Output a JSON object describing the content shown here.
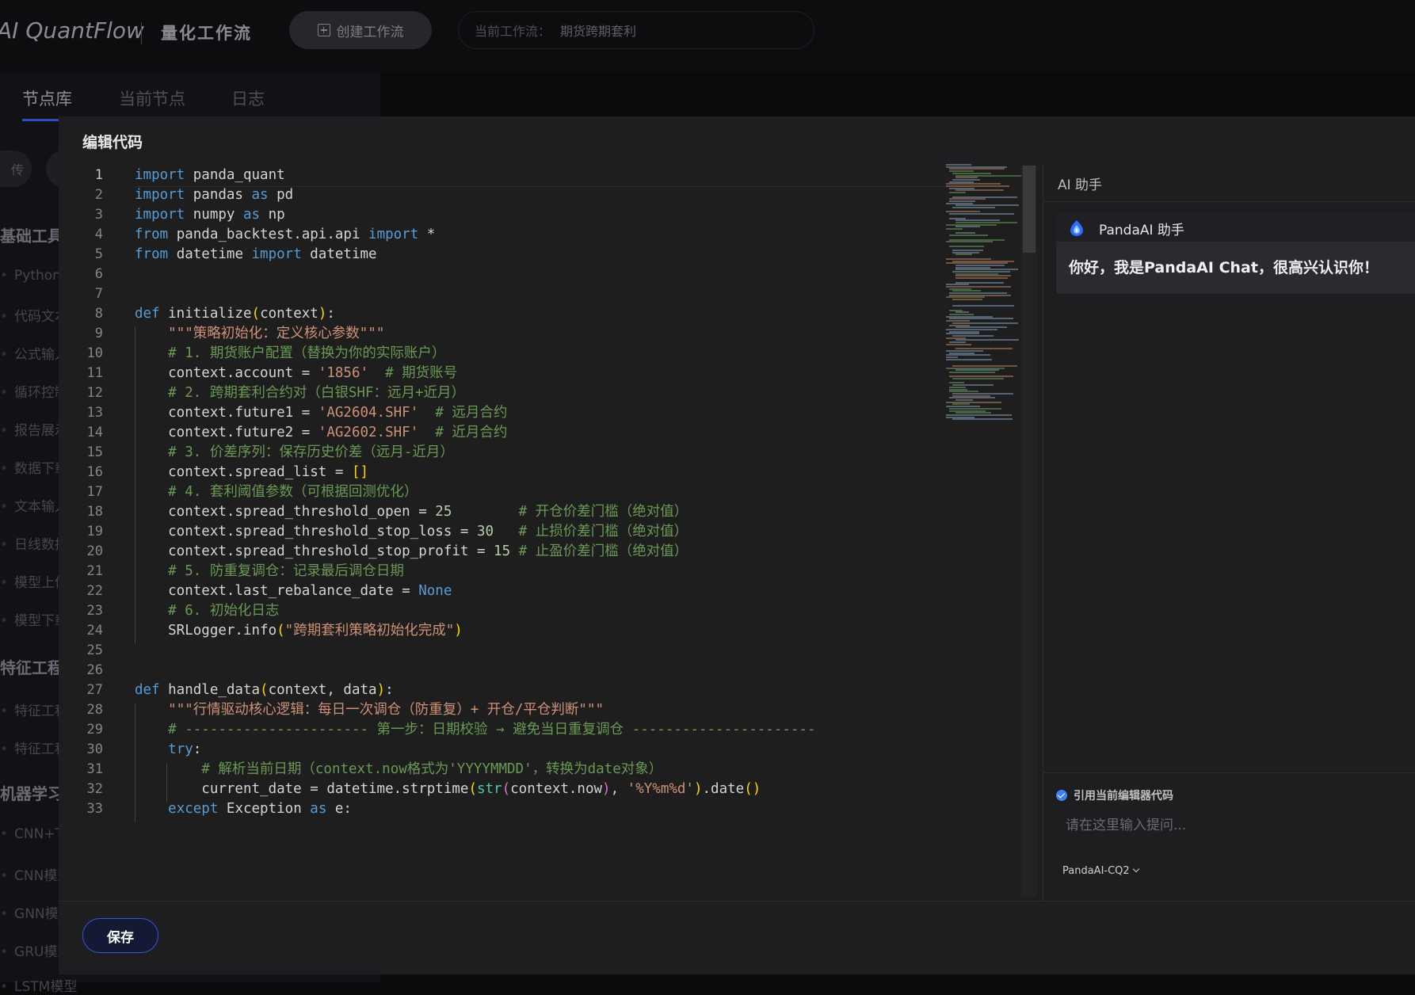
{
  "header": {
    "brand": "AI QuantFlow",
    "subbrand": "量化工作流",
    "create_button": "创建工作流",
    "current_workflow_label": "当前工作流：",
    "current_workflow_value": "期货跨期套利"
  },
  "left_tabs": [
    {
      "label": "节点库",
      "active": true
    },
    {
      "label": "当前节点",
      "active": false
    },
    {
      "label": "日志",
      "active": false
    }
  ],
  "left_panel": {
    "upload_label": "传",
    "categories": [
      {
        "label": "基础工具",
        "items": [
          "Python",
          "代码文本",
          "公式输入",
          "循环控制",
          "报告展示",
          "数据下载",
          "文本输入",
          "日线数据",
          "模型上传",
          "模型下载"
        ]
      },
      {
        "label": "特征工程",
        "items": [
          "特征工程",
          "特征工程"
        ]
      },
      {
        "label": "机器学习",
        "items": [
          "CNN+T",
          "CNN模型",
          "GNN模型",
          "GRU模型",
          "LSTM模型"
        ]
      }
    ]
  },
  "modal": {
    "title": "编辑代码",
    "save_button": "保存",
    "code_lines": [
      "import panda_quant",
      "import pandas as pd",
      "import numpy as np",
      "from panda_backtest.api.api import *",
      "from datetime import datetime",
      "",
      "",
      "def initialize(context):",
      "    \"\"\"策略初始化：定义核心参数\"\"\"",
      "    # 1. 期货账户配置（替换为你的实际账户）",
      "    context.account = '1856'  # 期货账号",
      "    # 2. 跨期套利合约对（白银SHF：远月+近月）",
      "    context.future1 = 'AG2604.SHF'  # 远月合约",
      "    context.future2 = 'AG2602.SHF'  # 近月合约",
      "    # 3. 价差序列：保存历史价差（远月-近月）",
      "    context.spread_list = []",
      "    # 4. 套利阈值参数（可根据回测优化）",
      "    context.spread_threshold_open = 25        # 开仓价差门槛（绝对值）",
      "    context.spread_threshold_stop_loss = 30   # 止损价差门槛（绝对值）",
      "    context.spread_threshold_stop_profit = 15 # 止盈价差门槛（绝对值）",
      "    # 5. 防重复调仓：记录最后调仓日期",
      "    context.last_rebalance_date = None",
      "    # 6. 初始化日志",
      "    SRLogger.info(\"跨期套利策略初始化完成\")",
      "",
      "",
      "def handle_data(context, data):",
      "    \"\"\"行情驱动核心逻辑：每日一次调仓（防重复）+ 开仓/平仓判断\"\"\"",
      "    # ---------------------- 第一步：日期校验 → 避免当日重复调仓 ----------------------",
      "    try:",
      "        # 解析当前日期（context.now格式为'YYYYMMDD'，转换为date对象）",
      "        current_date = datetime.strptime(str(context.now), '%Y%m%d').date()",
      "    except Exception as e:"
    ],
    "line_numbers": [
      "1",
      "2",
      "3",
      "4",
      "5",
      "6",
      "7",
      "8",
      "9",
      "10",
      "11",
      "12",
      "13",
      "14",
      "15",
      "16",
      "17",
      "18",
      "19",
      "20",
      "21",
      "22",
      "23",
      "24",
      "25",
      "26",
      "27",
      "28",
      "29",
      "30",
      "31",
      "32",
      "33"
    ]
  },
  "ai_panel": {
    "title": "AI 助手",
    "assistant_name": "PandaAI 助手",
    "greeting": "你好，我是PandaAI Chat，很高兴认识你！",
    "reference_label": "引用当前编辑器代码",
    "reference_checked": true,
    "input_placeholder": "请在这里输入提问...",
    "model": "PandaAI-CQ2"
  },
  "colors": {
    "accent": "#3558d8",
    "keyword": "#569cd6",
    "string": "#ce9178",
    "comment": "#6a9955",
    "number": "#b5cea8"
  }
}
